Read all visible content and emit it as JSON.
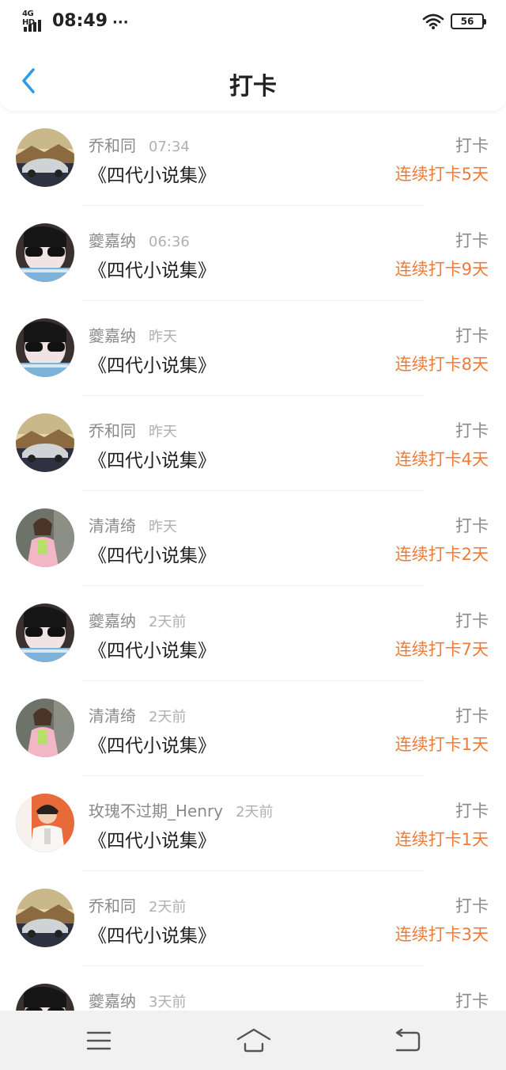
{
  "status_bar": {
    "network": "4G HD",
    "time": "08:49",
    "more": "···",
    "battery": "56"
  },
  "header": {
    "title": "打卡",
    "back_icon": "chevron-left-icon"
  },
  "colors": {
    "accent": "#2c9be6",
    "streak": "#f07a3a"
  },
  "entries": [
    {
      "name": "乔和同",
      "time": "07:34",
      "book": "《四代小说集》",
      "action": "打卡",
      "streak": "连续打卡5天",
      "avatar": "car"
    },
    {
      "name": "夔嘉纳",
      "time": "06:36",
      "book": "《四代小说集》",
      "action": "打卡",
      "streak": "连续打卡9天",
      "avatar": "sunglasses"
    },
    {
      "name": "夔嘉纳",
      "time": "昨天",
      "book": "《四代小说集》",
      "action": "打卡",
      "streak": "连续打卡8天",
      "avatar": "sunglasses"
    },
    {
      "name": "乔和同",
      "time": "昨天",
      "book": "《四代小说集》",
      "action": "打卡",
      "streak": "连续打卡4天",
      "avatar": "car"
    },
    {
      "name": "清清绮",
      "time": "昨天",
      "book": "《四代小说集》",
      "action": "打卡",
      "streak": "连续打卡2天",
      "avatar": "girl"
    },
    {
      "name": "夔嘉纳",
      "time": "2天前",
      "book": "《四代小说集》",
      "action": "打卡",
      "streak": "连续打卡7天",
      "avatar": "sunglasses"
    },
    {
      "name": "清清绮",
      "time": "2天前",
      "book": "《四代小说集》",
      "action": "打卡",
      "streak": "连续打卡1天",
      "avatar": "girl"
    },
    {
      "name": "玫瑰不过期_Henry",
      "time": "2天前",
      "book": "《四代小说集》",
      "action": "打卡",
      "streak": "连续打卡1天",
      "avatar": "boy"
    },
    {
      "name": "乔和同",
      "time": "2天前",
      "book": "《四代小说集》",
      "action": "打卡",
      "streak": "连续打卡3天",
      "avatar": "car"
    },
    {
      "name": "夔嘉纳",
      "time": "3天前",
      "book": "",
      "action": "打卡",
      "streak": "",
      "avatar": "sunglasses"
    }
  ],
  "nav": {
    "menu_icon": "menu-icon",
    "home_icon": "home-icon",
    "back_icon": "back-icon"
  }
}
